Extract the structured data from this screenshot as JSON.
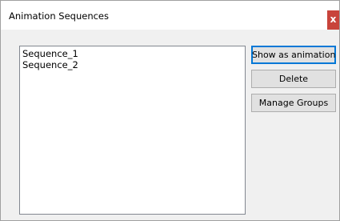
{
  "window": {
    "title": "Animation Sequences",
    "close_label": "x"
  },
  "sequences": {
    "items": [
      {
        "label": "Sequence_1"
      },
      {
        "label": "Sequence_2"
      }
    ]
  },
  "buttons": {
    "show_as_animation": "Show as animation",
    "delete": "Delete",
    "manage_groups": "Manage Groups"
  }
}
